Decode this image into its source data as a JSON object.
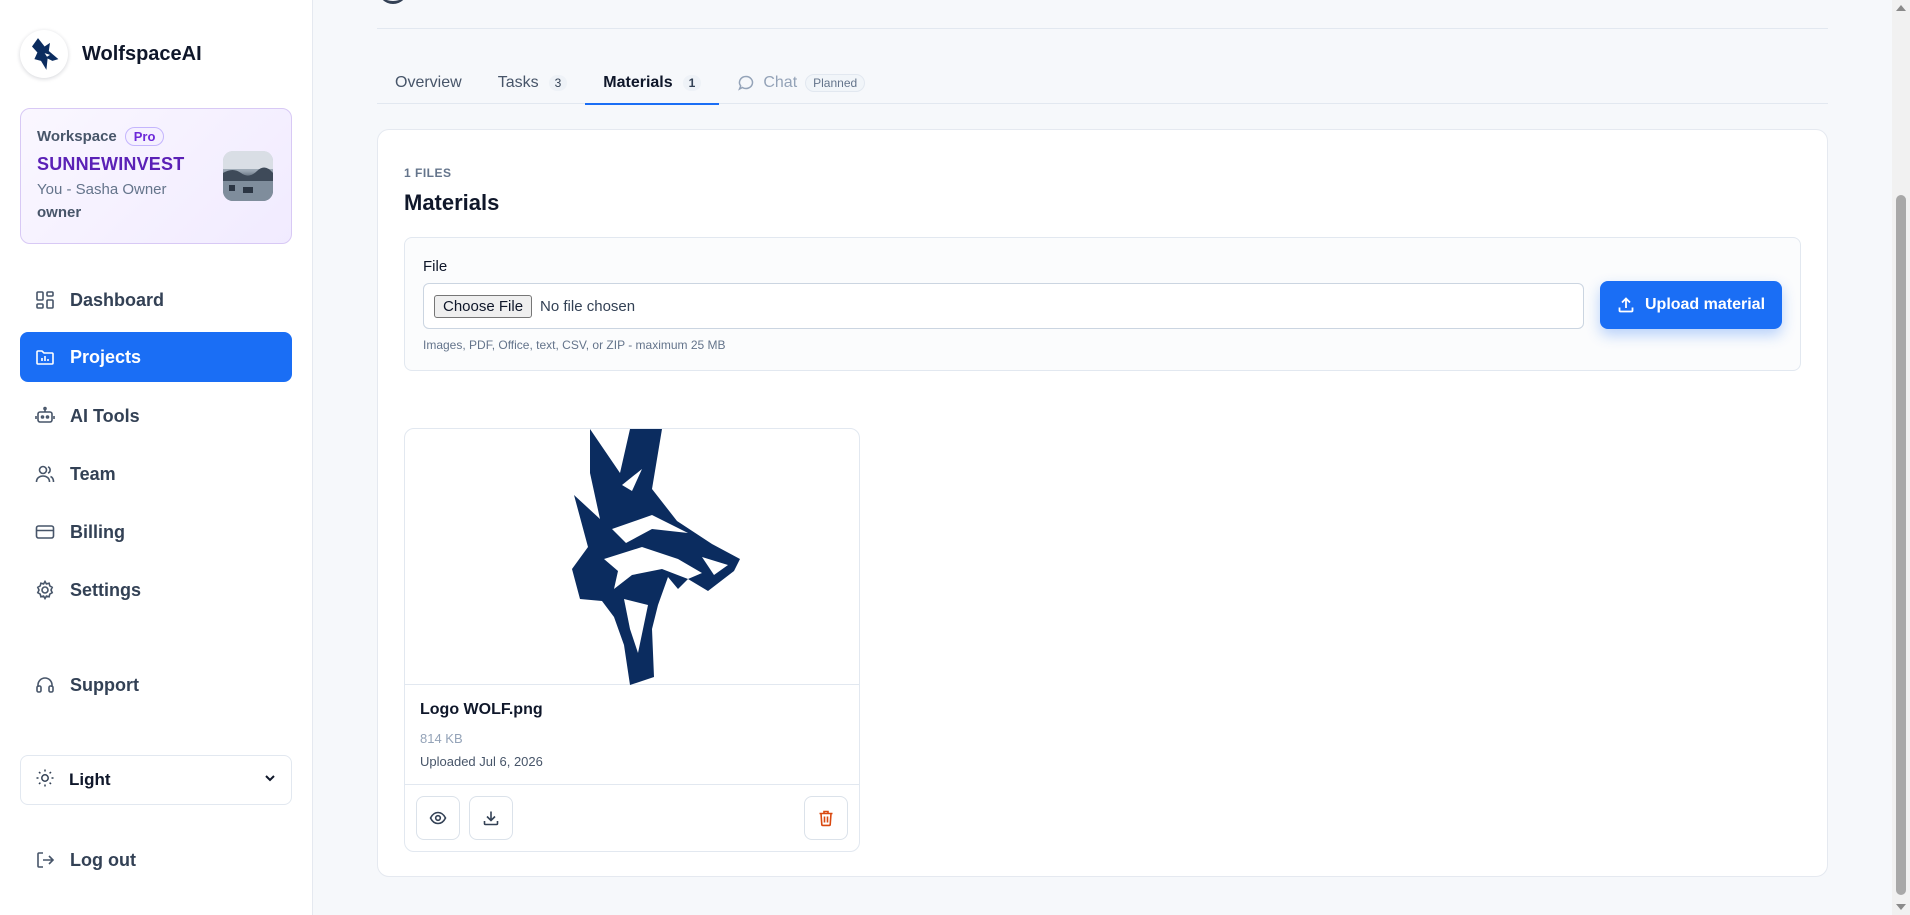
{
  "brand": {
    "name": "WolfspaceAI",
    "icon": "wolf-logo-icon"
  },
  "workspace": {
    "label": "Workspace",
    "plan": "Pro",
    "name": "SUNNEWINVEST",
    "user": "You - Sasha Owner",
    "role": "owner"
  },
  "nav": {
    "items": [
      {
        "label": "Dashboard",
        "icon": "dashboard-icon"
      },
      {
        "label": "Projects",
        "icon": "folder-icon",
        "active": true
      },
      {
        "label": "AI Tools",
        "icon": "robot-icon"
      },
      {
        "label": "Team",
        "icon": "users-icon"
      },
      {
        "label": "Billing",
        "icon": "credit-card-icon"
      },
      {
        "label": "Settings",
        "icon": "gear-icon"
      }
    ],
    "support": "Support",
    "logout": "Log out"
  },
  "theme": {
    "label": "Light",
    "icon": "sun-icon"
  },
  "tabs": [
    {
      "label": "Overview"
    },
    {
      "label": "Tasks",
      "badge": "3"
    },
    {
      "label": "Materials",
      "badge": "1",
      "active": true
    },
    {
      "label": "Chat",
      "tag": "Planned",
      "disabled": true
    }
  ],
  "materials": {
    "count_label": "1 FILES",
    "title": "Materials",
    "file_label": "File",
    "choose_button": "Choose File",
    "no_file": "No file chosen",
    "hint": "Images, PDF, Office, text, CSV, or ZIP - maximum 25 MB",
    "upload_button": "Upload material",
    "files": [
      {
        "name": "Logo WOLF.png",
        "size": "814 KB",
        "uploaded": "Uploaded Jul 6, 2026"
      }
    ]
  },
  "colors": {
    "accent": "#1a6ef5",
    "brand_navy": "#0b2c5f",
    "danger": "#d9480f",
    "workspace_name": "#5b21b6"
  }
}
